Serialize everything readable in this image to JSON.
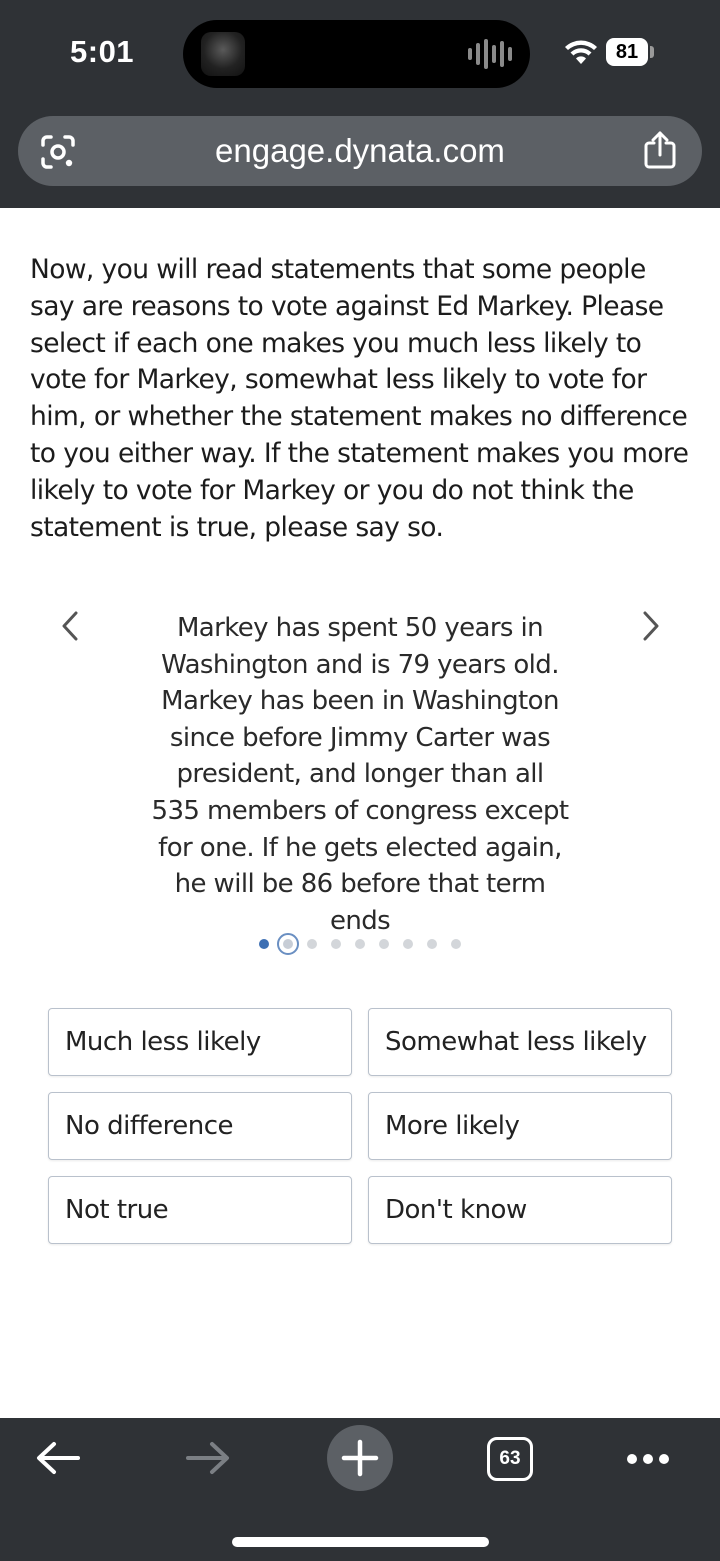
{
  "status_bar": {
    "time": "5:01",
    "battery": "81",
    "wifi_icon": "wifi-icon"
  },
  "browser": {
    "url": "engage.dynata.com",
    "lens_icon": "camera-lens-icon",
    "share_icon": "share-icon"
  },
  "survey": {
    "intro": "Now, you will read statements that some people say are reasons to vote against Ed Markey. Please select if each one makes you much less likely to vote for Markey, somewhat less likely to vote for him, or whether the statement makes no difference to you either way. If the statement makes you more likely to vote for Markey or you do not think the statement is true, please say so.",
    "statement": "Markey has spent 50 years in Washington and is 79 years old. Markey has been in Washington since before Jimmy Carter was president, and longer than all 535 members of congress except for one. If he gets elected again, he will be 86 before that term ends",
    "pagination": {
      "current": 2,
      "total": 9
    },
    "answers": [
      "Much less likely",
      "Somewhat less likely",
      "No difference",
      "More likely",
      "Not true",
      "Don't know"
    ]
  },
  "toolbar": {
    "tab_count": "63",
    "accent_color": "#3d6fb3"
  }
}
